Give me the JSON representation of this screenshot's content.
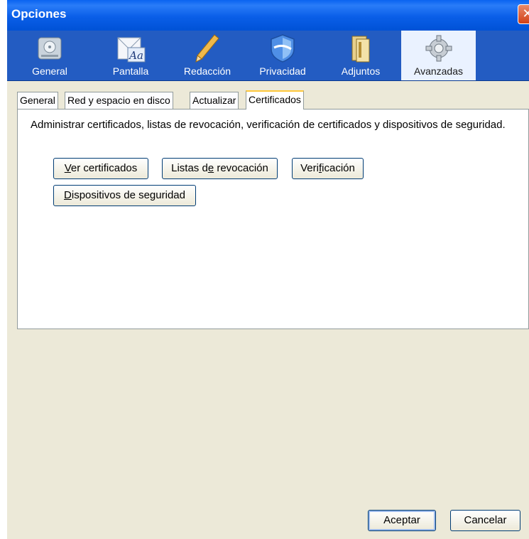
{
  "window": {
    "title": "Opciones",
    "close_label": "✕"
  },
  "categories": [
    {
      "label": "General",
      "icon": "drive-icon"
    },
    {
      "label": "Pantalla",
      "icon": "font-envelope-icon"
    },
    {
      "label": "Redacción",
      "icon": "pencil-icon"
    },
    {
      "label": "Privacidad",
      "icon": "shield-icon"
    },
    {
      "label": "Adjuntos",
      "icon": "folder-icon"
    },
    {
      "label": "Avanzadas",
      "icon": "gear-icon",
      "active": true
    }
  ],
  "subtabs": [
    {
      "label": "General"
    },
    {
      "label": "Red y espacio en disco"
    },
    {
      "label": "Actualizar"
    },
    {
      "label": "Certificados",
      "active": true
    }
  ],
  "certificates": {
    "description": "Administrar certificados, listas de revocación, verificación de certificados y dispositivos de seguridad.",
    "buttons": {
      "ver_mn": "V",
      "ver_rest": "er certificados",
      "listas_pre": "Listas d",
      "listas_mn": "e",
      "listas_post": " revocación",
      "verif_pre": "Veri",
      "verif_mn": "f",
      "verif_post": "icación",
      "disp_mn": "D",
      "disp_rest": "ispositivos de seguridad"
    }
  },
  "footer": {
    "accept": "Aceptar",
    "cancel": "Cancelar"
  },
  "colors": {
    "titlebar": "#0a5ee8",
    "toolbar": "#235cc2",
    "face": "#ece9d8",
    "tab_highlight": "#ffc83c"
  }
}
